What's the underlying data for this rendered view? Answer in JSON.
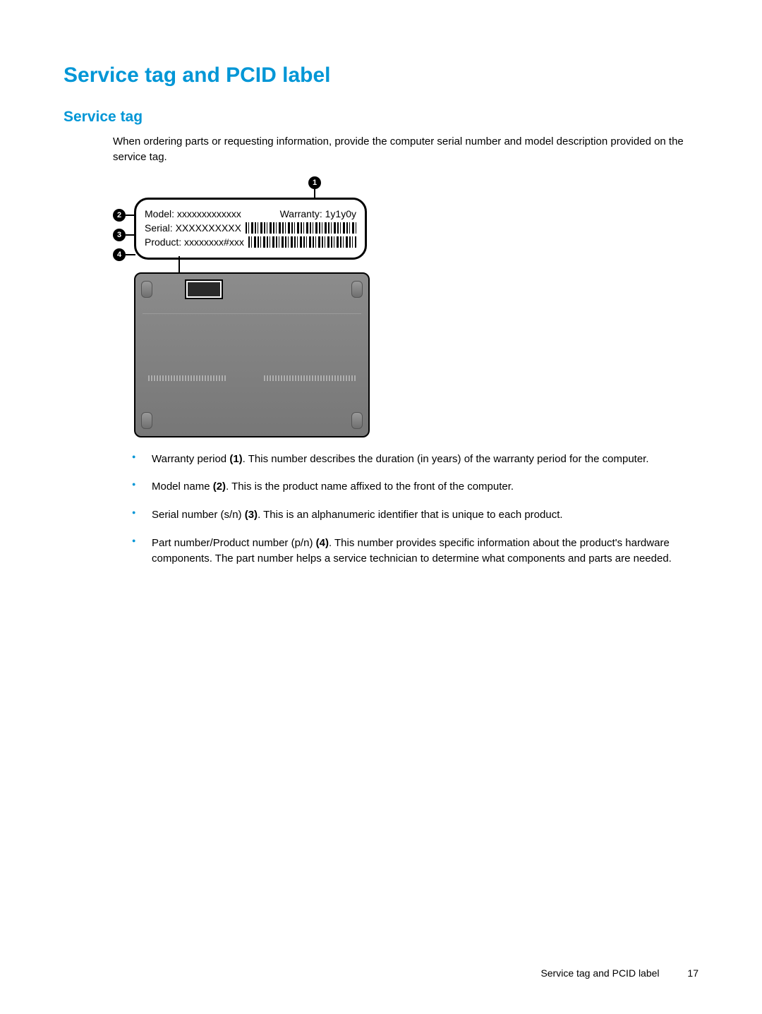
{
  "headings": {
    "h1": "Service tag and PCID label",
    "h2": "Service tag"
  },
  "intro": "When ordering parts or requesting information, provide the computer serial number and model description provided on the service tag.",
  "figure": {
    "callout1": "1",
    "callout2": "2",
    "callout3": "3",
    "callout4": "4",
    "model_label": "Model: xxxxxxxxxxxxx",
    "warranty_label": "Warranty: 1y1y0y",
    "serial_label": "Serial: XXXXXXXXXX",
    "product_label": "Product: xxxxxxxx#xxx"
  },
  "bullets": [
    {
      "lead": "Warranty period ",
      "bold": "(1)",
      "rest": ". This number describes the duration (in years) of the warranty period for the computer."
    },
    {
      "lead": "Model name ",
      "bold": "(2)",
      "rest": ". This is the product name affixed to the front of the computer."
    },
    {
      "lead": "Serial number (s/n) ",
      "bold": "(3)",
      "rest": ". This is an alphanumeric identifier that is unique to each product."
    },
    {
      "lead": "Part number/Product number (p/n) ",
      "bold": "(4)",
      "rest": ". This number provides specific information about the product's hardware components. The part number helps a service technician to determine what components and parts are needed."
    }
  ],
  "footer": {
    "section": "Service tag and PCID label",
    "page": "17"
  }
}
